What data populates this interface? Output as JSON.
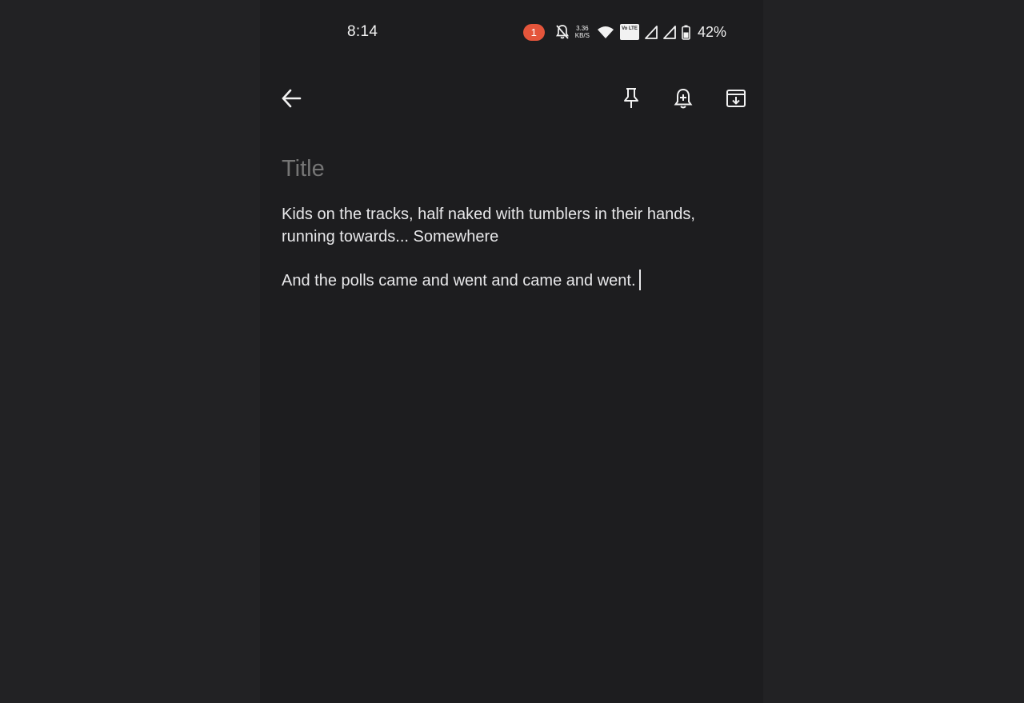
{
  "status_bar": {
    "time": "8:14",
    "notification_count": "1",
    "net_speed_value": "3.36",
    "net_speed_unit": "KB/S",
    "volte_label": "Vo LTE",
    "battery_percent": "42%"
  },
  "toolbar": {
    "back_icon": "arrow-left-icon",
    "pin_icon": "pin-icon",
    "reminder_icon": "bell-plus-icon",
    "archive_icon": "archive-icon"
  },
  "note": {
    "title_placeholder": "Title",
    "title_value": "",
    "paragraphs": [
      "Kids on the tracks, half naked with tumblers in their hands, running towards... Somewhere",
      "And the polls came and went and came and went."
    ]
  },
  "colors": {
    "background": "#1d1d1f",
    "notification_badge": "#e4553b",
    "text": "#e8e8ea",
    "placeholder": "#8f8f93"
  }
}
